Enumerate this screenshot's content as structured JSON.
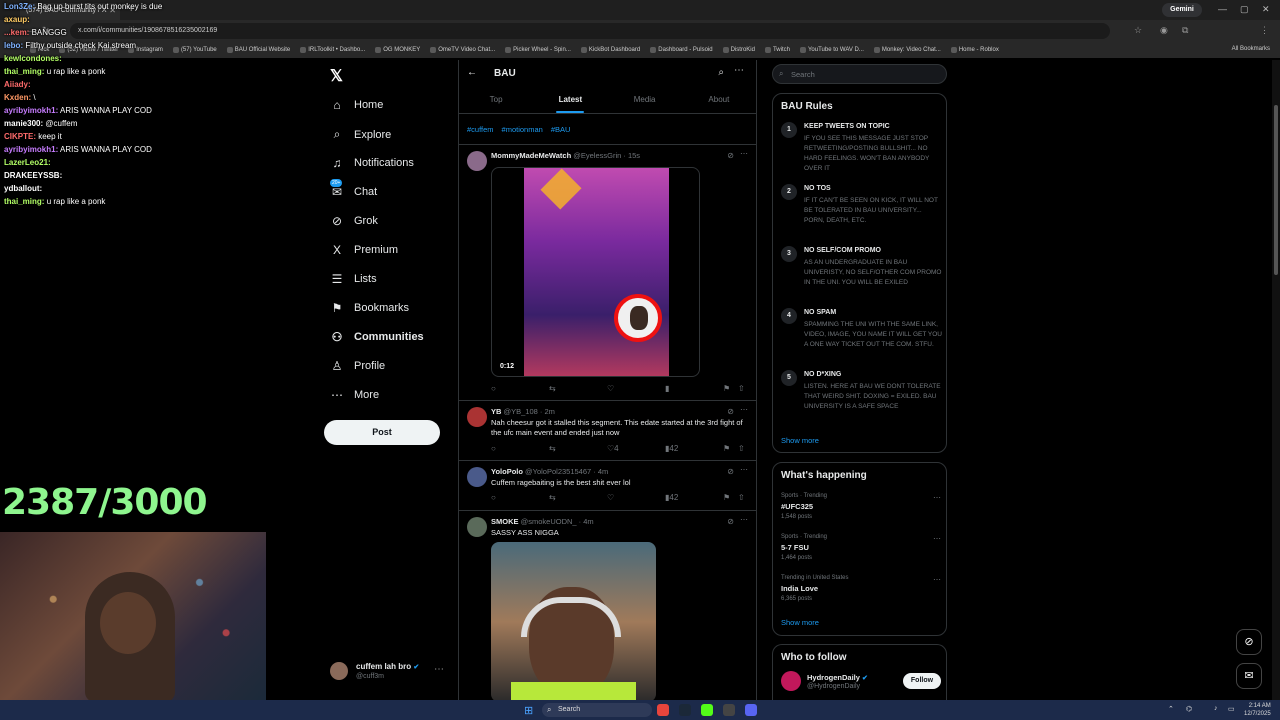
{
  "browser": {
    "tab_title": "(574) BAU Community / X",
    "url": "x.com/i/communities/1908678516235002169",
    "gemini": "Gemini",
    "all_bookmarks": "All Bookmarks",
    "bookmarks": [
      "Kick",
      "(52) Home / Twitter",
      "Instagram",
      "(57) YouTube",
      "BAU Official Website",
      "IRLToolkit • Dashbo...",
      "OG MONKEY",
      "OmeTV Video Chat...",
      "Picker Wheel - Spin...",
      "KickBot Dashboard",
      "Dashboard - Pulsoid",
      "DistroKid",
      "Twitch",
      "YouTube to WAV D...",
      "Monkey: Video Chat...",
      "Home - Roblox"
    ]
  },
  "overlay": {
    "chat": [
      {
        "user": "Lon3Ze:",
        "msg": "Bag up burst tits out monkey is due",
        "color": "#7fb2ff"
      },
      {
        "user": "axaup:",
        "msg": "",
        "color": "#ffcc66"
      },
      {
        "user": "...kem:",
        "msg": "BANGGG",
        "color": "#ff6b6b"
      },
      {
        "user": "lebo:",
        "msg": "Filthy outside check Kai stream",
        "color": "#7fb2ff"
      },
      {
        "user": "kewlcondones:",
        "msg": "",
        "color": "#b3ff66"
      },
      {
        "user": "thai_ming:",
        "msg": "u rap like a ponk",
        "color": "#b3ff66"
      },
      {
        "user": "Aiiady:",
        "msg": "",
        "color": "#ff6b6b"
      },
      {
        "user": "Kxden:",
        "msg": "\\",
        "color": "#ff9966"
      },
      {
        "user": "ayribyimokh1:",
        "msg": "ARIS WANNA PLAY COD",
        "color": "#c77dff"
      },
      {
        "user": "manie300:",
        "msg": "@cuffem",
        "color": "#ffffff"
      },
      {
        "user": "CIKPTE:",
        "msg": "keep it",
        "color": "#ff6b6b"
      },
      {
        "user": "ayribyimokh1:",
        "msg": "ARIS WANNA PLAY COD",
        "color": "#c77dff"
      },
      {
        "user": "LazerLeo21:",
        "msg": "",
        "color": "#b3ff66"
      },
      {
        "user": "DRAKEEYSSB:",
        "msg": "",
        "color": "#ffffff"
      },
      {
        "user": "ydballout:",
        "msg": "",
        "color": "#ffffff"
      },
      {
        "user": "thai_ming:",
        "msg": "u rap like a ponk",
        "color": "#b3ff66"
      }
    ],
    "counter": "2387/3000"
  },
  "nav": {
    "items": [
      {
        "label": "Home",
        "icon": "⌂"
      },
      {
        "label": "Explore",
        "icon": "⌕"
      },
      {
        "label": "Notifications",
        "icon": "♫"
      },
      {
        "label": "Chat",
        "icon": "✉"
      },
      {
        "label": "Grok",
        "icon": "⊘"
      },
      {
        "label": "Premium",
        "icon": "X"
      },
      {
        "label": "Lists",
        "icon": "☰"
      },
      {
        "label": "Bookmarks",
        "icon": "⚑"
      },
      {
        "label": "Communities",
        "icon": "⚇"
      },
      {
        "label": "Profile",
        "icon": "♙"
      },
      {
        "label": "More",
        "icon": "⋯"
      }
    ],
    "chat_badge": "20+",
    "post_label": "Post",
    "account_name": "cuffem lah bro",
    "account_handle": "@cuff3m"
  },
  "main": {
    "title": "BAU",
    "tabs": [
      "Top",
      "Latest",
      "Media",
      "About"
    ],
    "hashtags": [
      "#cuffem",
      "#motionman",
      "#BAU"
    ],
    "posts": [
      {
        "name": "MommyMadeMeWatch",
        "handle": "@EyelessGrin · 15s",
        "text": "",
        "duration": "0:12",
        "reply": "",
        "repost": "",
        "like": "",
        "views": ""
      },
      {
        "name": "YB",
        "handle": "@YB_108 · 2m",
        "text": "Nah cheesur got it stalled this segment. This edate started at the 3rd fight of the ufc main event and ended just now",
        "reply": "",
        "repost": "",
        "like": "4",
        "views": "42"
      },
      {
        "name": "YoloPolo",
        "handle": "@YoloPol23515467 · 4m",
        "text": "Cuffem ragebaiting is the best shit ever lol",
        "reply": "",
        "repost": "",
        "like": "",
        "views": "42"
      },
      {
        "name": "SMOKE",
        "handle": "@smokeUODN_ · 4m",
        "text": "SASSY ASS NIGGA"
      }
    ]
  },
  "right": {
    "search_placeholder": "Search",
    "rules_title": "BAU Rules",
    "rules": [
      {
        "n": "1",
        "title": "KEEP TWEETS ON TOPIC",
        "desc": "IF YOU SEE THIS MESSAGE JUST STOP RETWEETING/POSTING BULLSHIT... NO HARD FEELINGS. WON'T BAN ANYBODY OVER IT"
      },
      {
        "n": "2",
        "title": "NO TOS",
        "desc": "IF IT CAN'T BE SEEN ON KICK, IT WILL NOT BE TOLERATED IN BAU UNIVERSITY... PORN, DEATH, ETC."
      },
      {
        "n": "3",
        "title": "NO SELF/COM PROMO",
        "desc": "AS AN UNDERGRADUATE IN BAU UNIVERISTY, NO SELF/OTHER COM PROMO IN THE UNI. YOU WILL BE EXILED"
      },
      {
        "n": "4",
        "title": "NO SPAM",
        "desc": "SPAMMING THE UNI WITH THE SAME LINK, VIDEO, IMAGE, YOU NAME IT WILL GET YOU A ONE WAY TICKET OUT THE COM. STFU."
      },
      {
        "n": "5",
        "title": "NO D*XING",
        "desc": "LISTEN. HERE AT BAU WE DONT TOLERATE THAT WEIRD SHIT. DOXING = EXILED. BAU UNIVERSITY IS A SAFE SPACE"
      }
    ],
    "show_more": "Show more",
    "happening_title": "What's happening",
    "trends": [
      {
        "cat": "Sports · Trending",
        "name": "#UFC325",
        "posts": "1,548 posts"
      },
      {
        "cat": "Sports · Trending",
        "name": "5-7 FSU",
        "posts": "1,464 posts"
      },
      {
        "cat": "Trending in United States",
        "name": "India Love",
        "posts": "6,365 posts"
      }
    ],
    "who_title": "Who to follow",
    "follow": {
      "name": "HydrogenDaily",
      "handle": "@HydrogenDaily",
      "button": "Follow"
    }
  },
  "taskbar": {
    "search": "Search",
    "time": "2:14 AM",
    "date": "12/7/2025"
  }
}
